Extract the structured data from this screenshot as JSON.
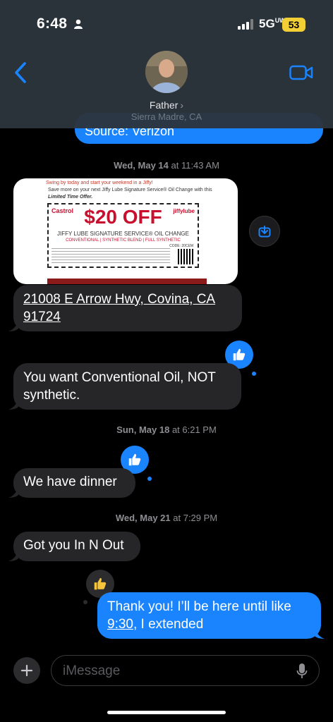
{
  "status_bar": {
    "time": "6:48",
    "network": "5G",
    "network_sub": "UW",
    "battery": "53"
  },
  "header": {
    "contact_name": "Father",
    "contact_location": "Sierra Madre, CA"
  },
  "messages": {
    "partial_out": "Source: Verizon",
    "ts1": {
      "day": "Wed, May 14",
      "time": "at 11:43 AM"
    },
    "attachment": {
      "promo_line1": "Swing by today and start your weekend in a Jiffy!",
      "promo_line2": "Save more on your next Jiffy Lube Signature Service® Oil Change with this",
      "promo_line3": "Limited Time Offer.",
      "brand_left": "Castrol",
      "brand_right": "jiffylube",
      "headline": "$20 OFF",
      "service": "JIFFY LUBE SIGNATURE SERVICE® OIL CHANGE",
      "types": "CONVENTIONAL | SYNTHETIC BLEND | FULL SYNTHETIC",
      "code_label": "CODE: 20CEM"
    },
    "address_line1": "21008 E Arrow Hwy, Covina, CA",
    "address_line2": "91724",
    "msg_conventional": "You want Conventional Oil, NOT synthetic.",
    "ts2": {
      "day": "Sun, May 18",
      "time": "at 6:21 PM"
    },
    "msg_dinner": "We have dinner",
    "ts3": {
      "day": "Wed, May 21",
      "time": "at 7:29 PM"
    },
    "msg_innout": "Got you In N Out",
    "msg_thanks_part1": "Thank you! I’ll be here until like",
    "msg_thanks_link": "9:30",
    "msg_thanks_part2": ", I extended"
  },
  "input": {
    "placeholder": "iMessage"
  },
  "colors": {
    "accent": "#1a84ff",
    "incoming_bubble": "#262628",
    "battery": "#f2cf34"
  }
}
